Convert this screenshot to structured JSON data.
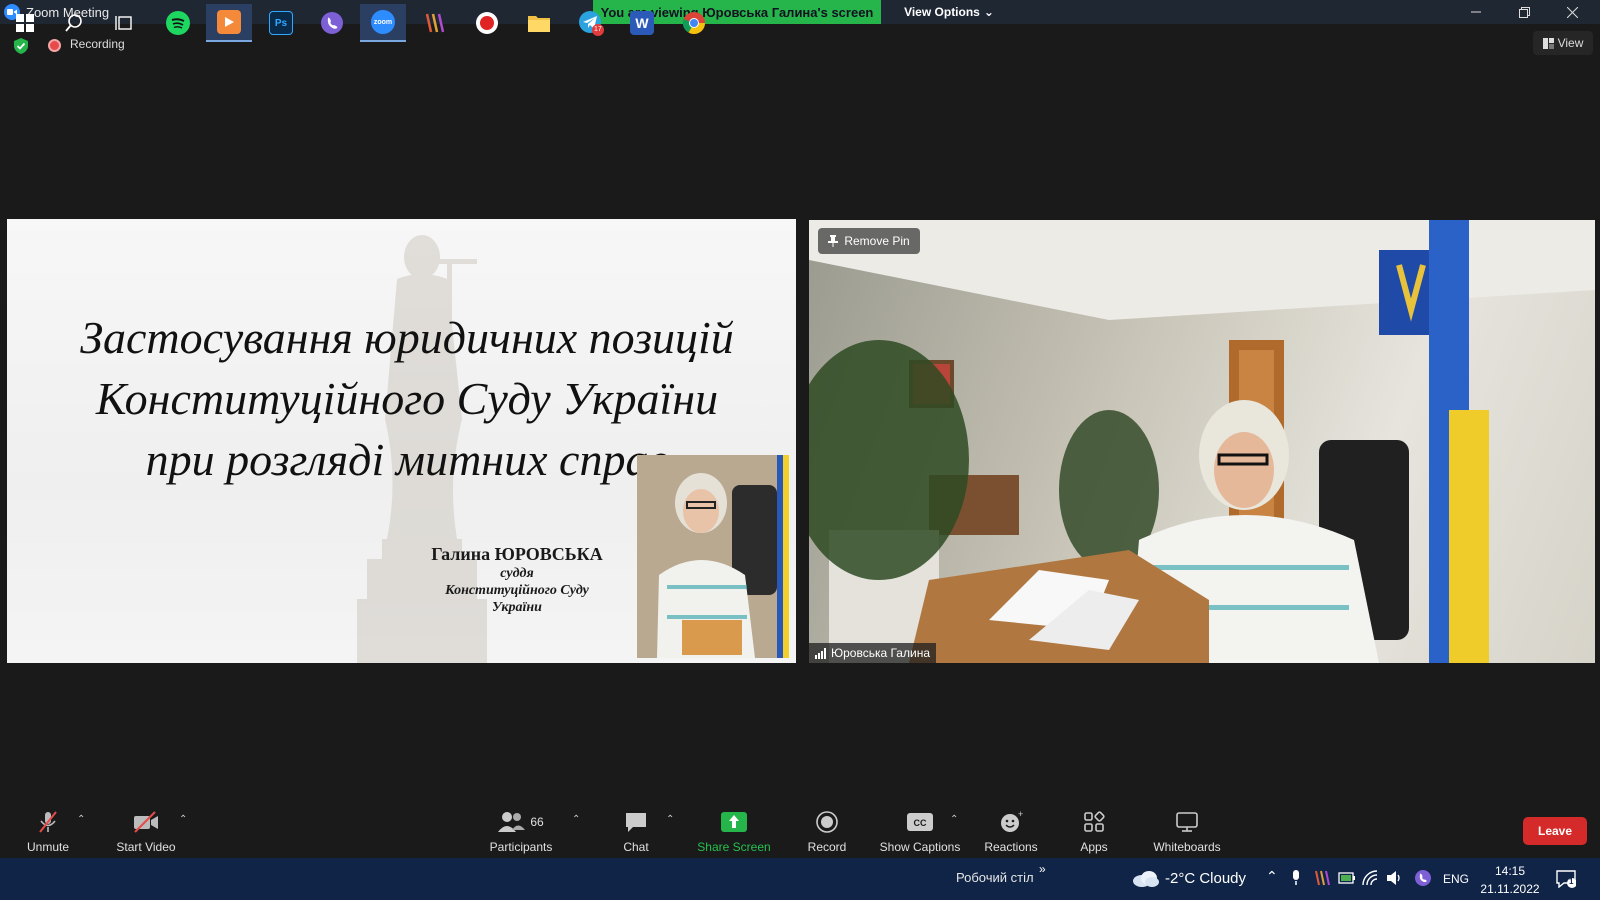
{
  "window": {
    "title": "Zoom Meeting",
    "viewing_banner": "You are viewing Юровська Галина's screen",
    "view_options_label": "View Options"
  },
  "status": {
    "recording_label": "Recording",
    "view_label": "View"
  },
  "shared_slide": {
    "title_lines": [
      "Застосування юридичних позицій",
      "Конституційного Суду України",
      "при розгляді митних справ"
    ],
    "speaker_name": "Галина ЮРОВСЬКА",
    "speaker_role_lines": [
      "суддя",
      "Конституційного Суду",
      "України"
    ]
  },
  "video": {
    "remove_pin_label": "Remove Pin",
    "participant_name": "Юровська Галина"
  },
  "toolbar": {
    "unmute": "Unmute",
    "start_video": "Start Video",
    "participants": "Participants",
    "participants_count": "66",
    "chat": "Chat",
    "share_screen": "Share Screen",
    "record": "Record",
    "show_captions": "Show Captions",
    "reactions": "Reactions",
    "apps": "Apps",
    "whiteboards": "Whiteboards",
    "leave": "Leave"
  },
  "taskbar": {
    "desktop_label": "Робочий стіл",
    "telegram_badge": "17",
    "weather": "-2°C  Cloudy",
    "language": "ENG",
    "time": "14:15",
    "date": "21.11.2022",
    "notifications_count": "1"
  },
  "colors": {
    "banner_green": "#26b54a",
    "leave_red": "#d52a2a",
    "taskbar_blue": "#0f2446",
    "zoom_blue": "#2d8cff"
  }
}
